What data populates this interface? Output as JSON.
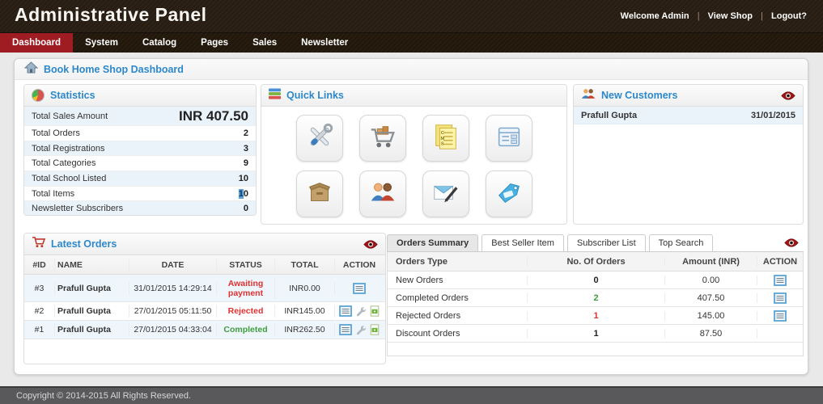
{
  "header": {
    "title": "Administrative Panel",
    "separator": "|",
    "links": [
      "Welcome Admin",
      "View Shop",
      "Logout?"
    ]
  },
  "nav": {
    "items": [
      {
        "label": "Dashboard",
        "active": true
      },
      {
        "label": "System",
        "active": false
      },
      {
        "label": "Catalog",
        "active": false
      },
      {
        "label": "Pages",
        "active": false
      },
      {
        "label": "Sales",
        "active": false
      },
      {
        "label": "Newsletter",
        "active": false
      }
    ]
  },
  "breadcrumb": "Book Home Shop Dashboard",
  "statistics": {
    "title": "Statistics",
    "icon": "pie-chart-icon",
    "rows": [
      {
        "label": "Total Sales Amount",
        "value": "INR 407.50"
      },
      {
        "label": "Total Orders",
        "value": "2"
      },
      {
        "label": "Total Registrations",
        "value": "3"
      },
      {
        "label": "Total Categories",
        "value": "9"
      },
      {
        "label": "Total School Listed",
        "value": "10"
      },
      {
        "label": "Total Items",
        "value_selected": "1",
        "value_rest": "0"
      },
      {
        "label": "Newsletter Subscribers",
        "value": "0"
      }
    ]
  },
  "quick_links": {
    "title": "Quick Links",
    "icon": "stacked-bars-icon",
    "items": [
      {
        "icon": "tools-icon"
      },
      {
        "icon": "cart-icon"
      },
      {
        "icon": "cms-pages-icon"
      },
      {
        "icon": "form-icon"
      },
      {
        "icon": "package-icon"
      },
      {
        "icon": "customers-icon"
      },
      {
        "icon": "newsletter-icon"
      },
      {
        "icon": "tag-icon"
      }
    ]
  },
  "new_customers": {
    "title": "New Customers",
    "icon": "customers-icon",
    "rows": [
      {
        "name": "Prafull Gupta",
        "date": "31/01/2015"
      }
    ]
  },
  "latest_orders": {
    "title": "Latest Orders",
    "icon": "cart-icon",
    "columns": [
      "#ID",
      "NAME",
      "DATE",
      "STATUS",
      "TOTAL",
      "ACTION"
    ],
    "rows": [
      {
        "id": "#3",
        "name": "Prafull Gupta",
        "date": "31/01/2015 14:29:14",
        "status": "Awaiting payment",
        "status_color": "red",
        "total": "INR0.00"
      },
      {
        "id": "#2",
        "name": "Prafull Gupta",
        "date": "27/01/2015 05:11:50",
        "status": "Rejected",
        "status_color": "red",
        "total": "INR145.00"
      },
      {
        "id": "#1",
        "name": "Prafull Gupta",
        "date": "27/01/2015 04:33:04",
        "status": "Completed",
        "status_color": "green",
        "total": "INR262.50"
      }
    ]
  },
  "orders_panel": {
    "tabs": [
      {
        "label": "Orders Summary",
        "active": true
      },
      {
        "label": "Best Seller Item",
        "active": false
      },
      {
        "label": "Subscriber List",
        "active": false
      },
      {
        "label": "Top Search",
        "active": false
      }
    ],
    "columns": [
      "Orders Type",
      "No. Of Orders",
      "Amount (INR)",
      "ACTION"
    ],
    "rows": [
      {
        "type": "New Orders",
        "count": "0",
        "count_color": "black",
        "amount": "0.00",
        "has_action": true
      },
      {
        "type": "Completed Orders",
        "count": "2",
        "count_color": "green",
        "amount": "407.50",
        "has_action": true
      },
      {
        "type": "Rejected Orders",
        "count": "1",
        "count_color": "red",
        "amount": "145.00",
        "has_action": true
      },
      {
        "type": "Discount Orders",
        "count": "1",
        "count_color": "black",
        "amount": "87.50",
        "has_action": false
      }
    ]
  },
  "footer": {
    "copyright": "Copyright © 2014-2015 All Rights Reserved."
  },
  "colors": {
    "accent_blue": "#2d88cb",
    "nav_active_red": "#9e1c22",
    "status_red": "#e03131",
    "status_green": "#3f9e3f",
    "header_brown": "#2b2015",
    "footer_gray": "#59585b",
    "row_tint": "#eaf3fa"
  }
}
